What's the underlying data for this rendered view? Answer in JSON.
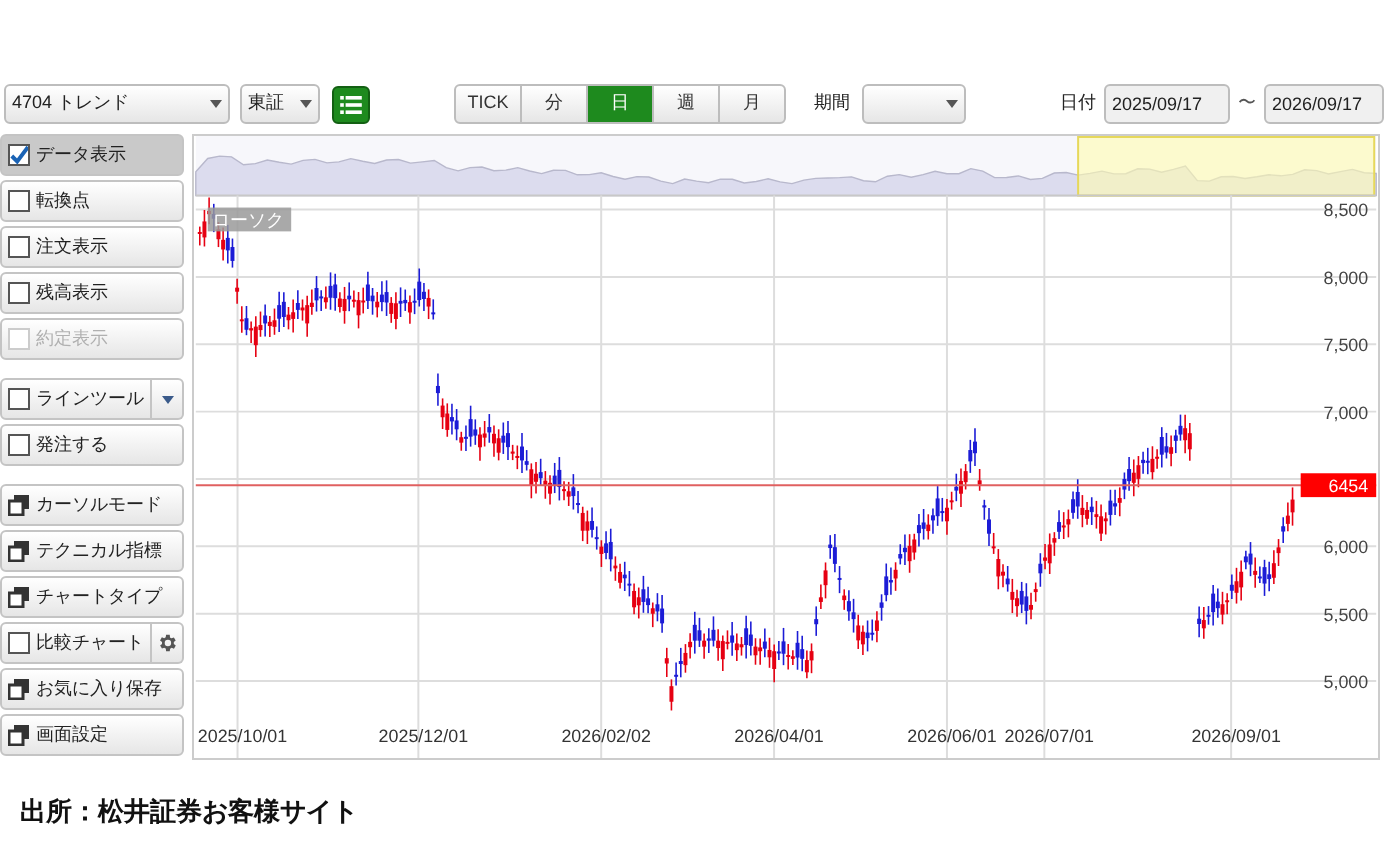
{
  "toolbar": {
    "symbol": "4704 トレンド",
    "market": "東証",
    "periods": [
      {
        "label": "TICK",
        "selected": false
      },
      {
        "label": "分",
        "selected": false
      },
      {
        "label": "日",
        "selected": true
      },
      {
        "label": "週",
        "selected": false
      },
      {
        "label": "月",
        "selected": false
      }
    ],
    "range_label": "期間",
    "date_label": "日付",
    "date_from": "2025/09/17",
    "date_separator": "〜",
    "date_to": "2026/09/17"
  },
  "sidebar": {
    "groups": [
      [
        {
          "kind": "checkbox",
          "label": "データ表示",
          "checked": true,
          "selected": true,
          "disabled": false
        },
        {
          "kind": "checkbox",
          "label": "転換点",
          "checked": false,
          "selected": false,
          "disabled": false
        },
        {
          "kind": "checkbox",
          "label": "注文表示",
          "checked": false,
          "selected": false,
          "disabled": false
        },
        {
          "kind": "checkbox",
          "label": "残高表示",
          "checked": false,
          "selected": false,
          "disabled": false
        },
        {
          "kind": "checkbox",
          "label": "約定表示",
          "checked": false,
          "selected": false,
          "disabled": true
        }
      ],
      [
        {
          "kind": "checkbox",
          "label": "ラインツール",
          "checked": false,
          "selected": false,
          "disabled": false,
          "has_dropdown": true
        },
        {
          "kind": "checkbox",
          "label": "発注する",
          "checked": false,
          "selected": false,
          "disabled": false
        }
      ],
      [
        {
          "kind": "window",
          "label": "カーソルモード",
          "selected": false,
          "disabled": false
        },
        {
          "kind": "window",
          "label": "テクニカル指標",
          "selected": false,
          "disabled": false
        },
        {
          "kind": "window",
          "label": "チャートタイプ",
          "selected": false,
          "disabled": false
        },
        {
          "kind": "checkbox",
          "label": "比較チャート",
          "checked": false,
          "selected": false,
          "disabled": false,
          "has_settings": true
        },
        {
          "kind": "window",
          "label": "お気に入り保存",
          "selected": false,
          "disabled": false
        },
        {
          "kind": "window",
          "label": "画面設定",
          "selected": false,
          "disabled": false
        }
      ]
    ]
  },
  "chart": {
    "series_label": "ローソク",
    "yticks": [
      "8,500",
      "8,000",
      "7,500",
      "7,000",
      "6,000",
      "5,500",
      "5,000"
    ],
    "xlabels": [
      "2025/10/01",
      "2025/12/01",
      "2026/02/02",
      "2026/04/01",
      "2026/06/01",
      "2026/07/01",
      "2026/09/01"
    ],
    "price_tag": "6454"
  },
  "caption": "出所：松井証券お客様サイト"
}
